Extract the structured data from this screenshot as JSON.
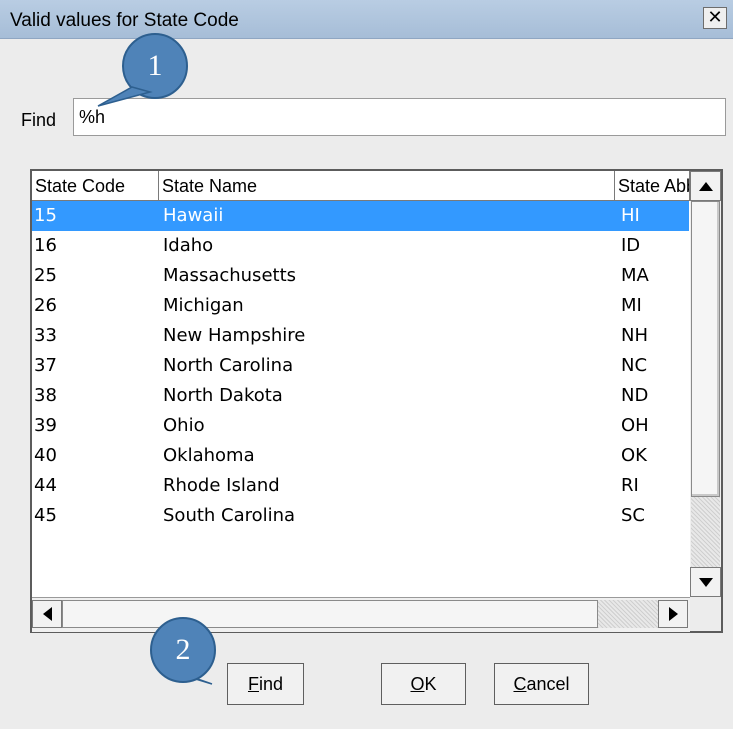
{
  "window": {
    "title": "Valid values for State Code",
    "close_glyph": "✕"
  },
  "search": {
    "label": "Find",
    "value": "%h"
  },
  "table": {
    "columns": [
      "State Code",
      "State Name",
      "State Abbr"
    ],
    "rows": [
      {
        "code": "15",
        "name": "Hawaii",
        "abbr": "HI",
        "selected": true
      },
      {
        "code": "16",
        "name": "Idaho",
        "abbr": "ID"
      },
      {
        "code": "25",
        "name": "Massachusetts",
        "abbr": "MA"
      },
      {
        "code": "26",
        "name": "Michigan",
        "abbr": "MI"
      },
      {
        "code": "33",
        "name": "New Hampshire",
        "abbr": "NH"
      },
      {
        "code": "37",
        "name": "North Carolina",
        "abbr": "NC"
      },
      {
        "code": "38",
        "name": "North Dakota",
        "abbr": "ND"
      },
      {
        "code": "39",
        "name": "Ohio",
        "abbr": "OH"
      },
      {
        "code": "40",
        "name": "Oklahoma",
        "abbr": "OK"
      },
      {
        "code": "44",
        "name": "Rhode Island",
        "abbr": "RI"
      },
      {
        "code": "45",
        "name": "South Carolina",
        "abbr": "SC"
      }
    ],
    "selected_color": "#3399ff"
  },
  "buttons": {
    "find": {
      "label": "Find",
      "mnemonic": "F"
    },
    "ok": {
      "label": "OK",
      "mnemonic": "O"
    },
    "cancel": {
      "label": "Cancel",
      "mnemonic": "C"
    }
  },
  "scroll_icons": {
    "up": "scroll-up-arrow-icon",
    "down": "scroll-down-arrow-icon",
    "left": "scroll-left-arrow-icon",
    "right": "scroll-right-arrow-icon"
  },
  "callouts": [
    {
      "number": "1"
    },
    {
      "number": "2"
    }
  ],
  "callout_color": "#4f83b8"
}
